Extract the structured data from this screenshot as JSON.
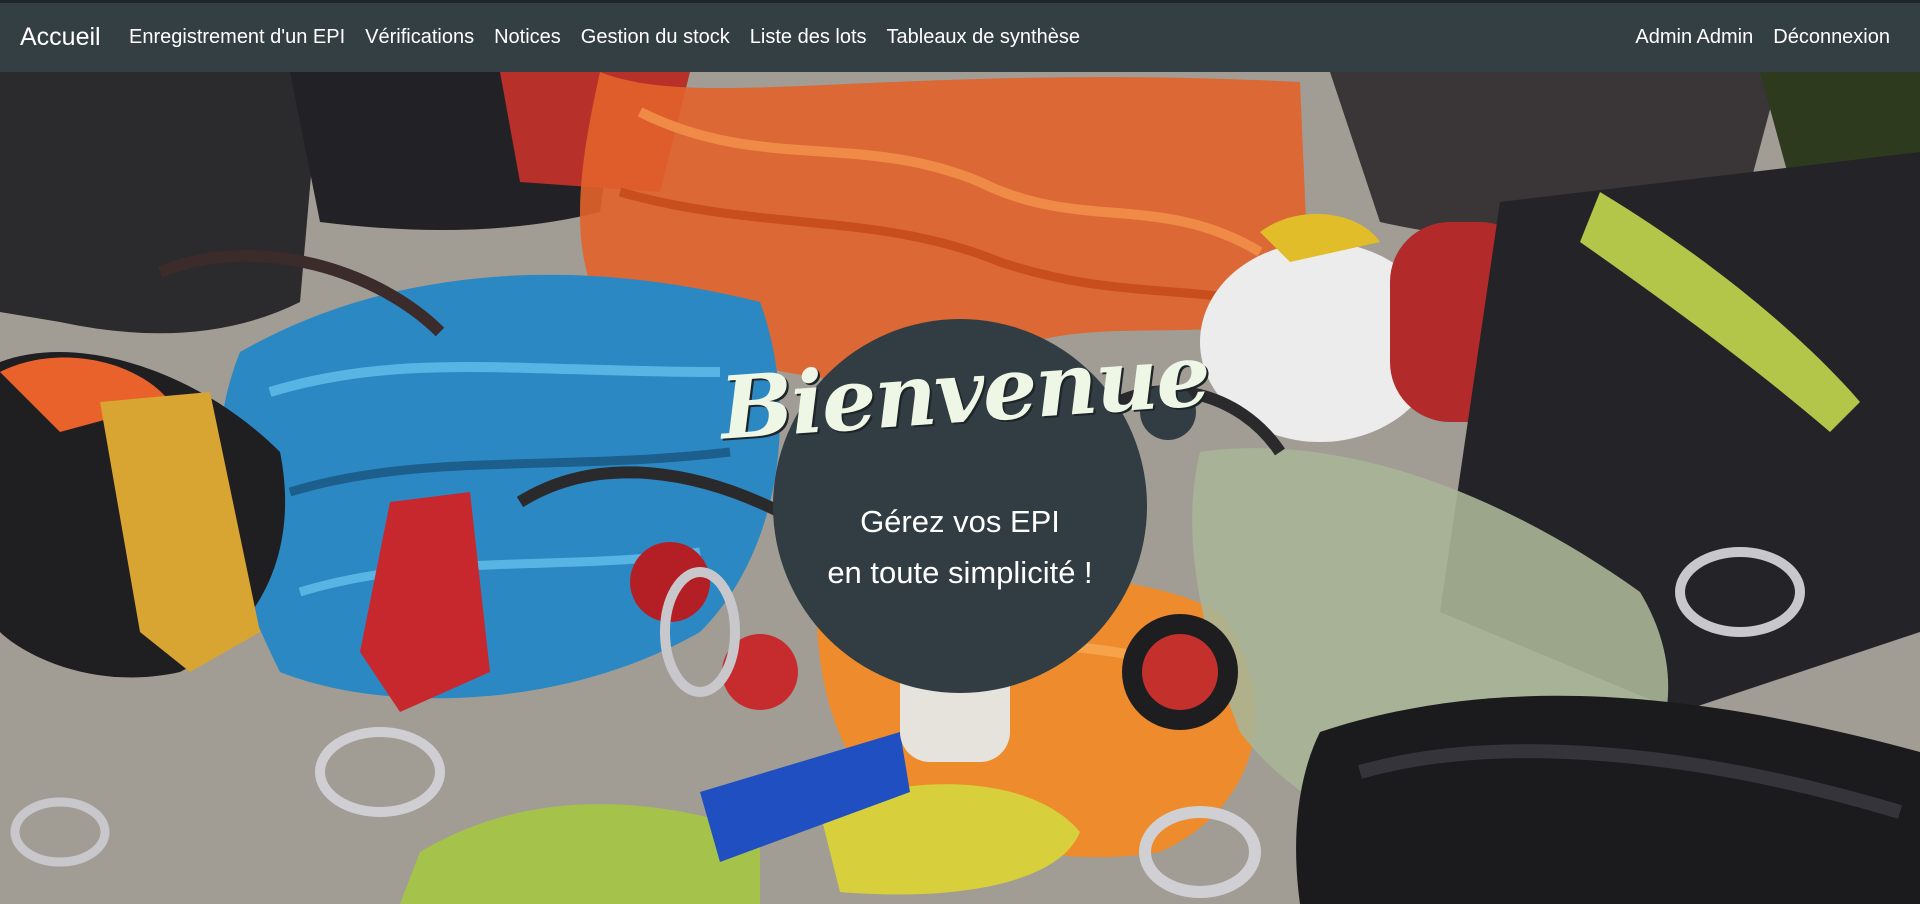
{
  "navbar": {
    "brand": "Accueil",
    "links": [
      "Enregistrement d'un EPI",
      "Vérifications",
      "Notices",
      "Gestion du stock",
      "Liste des lots",
      "Tableaux de synthèse"
    ],
    "user": "Admin Admin",
    "logout": "Déconnexion"
  },
  "hero": {
    "title": "Bienvenue",
    "subtitle_line1": "Gérez vos EPI",
    "subtitle_line2": "en toute simplicité !"
  },
  "colors": {
    "navbar_bg": "#343f43",
    "badge_bg": "#313d42",
    "title_text": "#eef6e6"
  }
}
